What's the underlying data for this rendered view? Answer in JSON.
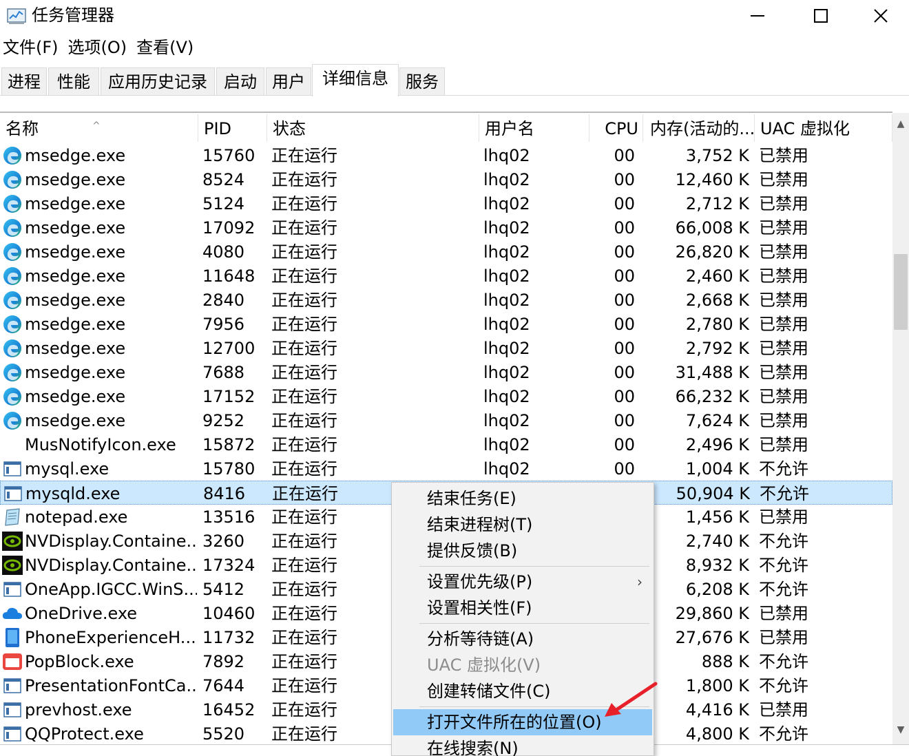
{
  "window": {
    "title": "任务管理器",
    "controls": [
      "minimize",
      "maximize",
      "close"
    ]
  },
  "menu": [
    "文件(F)",
    "选项(O)",
    "查看(V)"
  ],
  "tabs": [
    "进程",
    "性能",
    "应用历史记录",
    "启动",
    "用户",
    "详细信息",
    "服务"
  ],
  "active_tab": "详细信息",
  "columns": {
    "name": "名称",
    "pid": "PID",
    "status": "状态",
    "user": "用户名",
    "cpu": "CPU",
    "memory": "内存(活动的...",
    "uac": "UAC 虚拟化"
  },
  "rows": [
    {
      "icon": "edge-icon",
      "name": "msedge.exe",
      "pid": "15760",
      "status": "正在运行",
      "user": "lhq02",
      "cpu": "00",
      "mem": "3,752 K",
      "uac": "已禁用"
    },
    {
      "icon": "edge-icon",
      "name": "msedge.exe",
      "pid": "8524",
      "status": "正在运行",
      "user": "lhq02",
      "cpu": "00",
      "mem": "12,460 K",
      "uac": "已禁用"
    },
    {
      "icon": "edge-icon",
      "name": "msedge.exe",
      "pid": "5124",
      "status": "正在运行",
      "user": "lhq02",
      "cpu": "00",
      "mem": "2,712 K",
      "uac": "已禁用"
    },
    {
      "icon": "edge-icon",
      "name": "msedge.exe",
      "pid": "17092",
      "status": "正在运行",
      "user": "lhq02",
      "cpu": "00",
      "mem": "66,008 K",
      "uac": "已禁用"
    },
    {
      "icon": "edge-icon",
      "name": "msedge.exe",
      "pid": "4080",
      "status": "正在运行",
      "user": "lhq02",
      "cpu": "00",
      "mem": "26,820 K",
      "uac": "已禁用"
    },
    {
      "icon": "edge-icon",
      "name": "msedge.exe",
      "pid": "11648",
      "status": "正在运行",
      "user": "lhq02",
      "cpu": "00",
      "mem": "2,460 K",
      "uac": "已禁用"
    },
    {
      "icon": "edge-icon",
      "name": "msedge.exe",
      "pid": "2840",
      "status": "正在运行",
      "user": "lhq02",
      "cpu": "00",
      "mem": "2,668 K",
      "uac": "已禁用"
    },
    {
      "icon": "edge-icon",
      "name": "msedge.exe",
      "pid": "7956",
      "status": "正在运行",
      "user": "lhq02",
      "cpu": "00",
      "mem": "2,780 K",
      "uac": "已禁用"
    },
    {
      "icon": "edge-icon",
      "name": "msedge.exe",
      "pid": "12700",
      "status": "正在运行",
      "user": "lhq02",
      "cpu": "00",
      "mem": "2,792 K",
      "uac": "已禁用"
    },
    {
      "icon": "edge-icon",
      "name": "msedge.exe",
      "pid": "7688",
      "status": "正在运行",
      "user": "lhq02",
      "cpu": "00",
      "mem": "31,488 K",
      "uac": "已禁用"
    },
    {
      "icon": "edge-icon",
      "name": "msedge.exe",
      "pid": "17152",
      "status": "正在运行",
      "user": "lhq02",
      "cpu": "00",
      "mem": "66,232 K",
      "uac": "已禁用"
    },
    {
      "icon": "edge-icon",
      "name": "msedge.exe",
      "pid": "9252",
      "status": "正在运行",
      "user": "lhq02",
      "cpu": "00",
      "mem": "7,624 K",
      "uac": "已禁用"
    },
    {
      "icon": "none",
      "name": "MusNotifyIcon.exe",
      "pid": "15872",
      "status": "正在运行",
      "user": "lhq02",
      "cpu": "00",
      "mem": "2,496 K",
      "uac": "已禁用"
    },
    {
      "icon": "window-app-icon",
      "name": "mysql.exe",
      "pid": "15780",
      "status": "正在运行",
      "user": "lhq02",
      "cpu": "00",
      "mem": "1,004 K",
      "uac": "不允许"
    },
    {
      "icon": "window-app-icon",
      "name": "mysqld.exe",
      "pid": "8416",
      "status": "正在运行",
      "user": "",
      "cpu": "",
      "mem": "50,904 K",
      "uac": "不允许",
      "selected": true
    },
    {
      "icon": "notepad-icon",
      "name": "notepad.exe",
      "pid": "13516",
      "status": "正在运行",
      "user": "",
      "cpu": "",
      "mem": "1,456 K",
      "uac": "已禁用"
    },
    {
      "icon": "nvidia-icon",
      "name": "NVDisplay.Containe...",
      "pid": "3260",
      "status": "正在运行",
      "user": "",
      "cpu": "",
      "mem": "2,740 K",
      "uac": "不允许"
    },
    {
      "icon": "nvidia-icon",
      "name": "NVDisplay.Containe...",
      "pid": "17324",
      "status": "正在运行",
      "user": "",
      "cpu": "",
      "mem": "8,932 K",
      "uac": "不允许"
    },
    {
      "icon": "window-app-icon",
      "name": "OneApp.IGCC.WinS...",
      "pid": "5412",
      "status": "正在运行",
      "user": "",
      "cpu": "",
      "mem": "6,208 K",
      "uac": "不允许"
    },
    {
      "icon": "onedrive-icon",
      "name": "OneDrive.exe",
      "pid": "10460",
      "status": "正在运行",
      "user": "",
      "cpu": "",
      "mem": "29,860 K",
      "uac": "已禁用"
    },
    {
      "icon": "phone-icon",
      "name": "PhoneExperienceH...",
      "pid": "11732",
      "status": "正在运行",
      "user": "",
      "cpu": "",
      "mem": "27,676 K",
      "uac": "已禁用"
    },
    {
      "icon": "popblock-icon",
      "name": "PopBlock.exe",
      "pid": "7892",
      "status": "正在运行",
      "user": "",
      "cpu": "",
      "mem": "888 K",
      "uac": "不允许"
    },
    {
      "icon": "window-app-icon",
      "name": "PresentationFontCa...",
      "pid": "7644",
      "status": "正在运行",
      "user": "",
      "cpu": "",
      "mem": "1,800 K",
      "uac": "不允许"
    },
    {
      "icon": "window-app-icon",
      "name": "prevhost.exe",
      "pid": "16452",
      "status": "正在运行",
      "user": "",
      "cpu": "",
      "mem": "4,416 K",
      "uac": "已禁用"
    },
    {
      "icon": "window-app-icon",
      "name": "QQProtect.exe",
      "pid": "5520",
      "status": "正在运行",
      "user": "",
      "cpu": "",
      "mem": "4,800 K",
      "uac": "不允许"
    }
  ],
  "context_menu": {
    "items": [
      {
        "label": "结束任务(E)",
        "state": "enabled"
      },
      {
        "label": "结束进程树(T)",
        "state": "enabled"
      },
      {
        "label": "提供反馈(B)",
        "state": "enabled"
      },
      {
        "label": "设置优先级(P)",
        "state": "enabled",
        "submenu": true
      },
      {
        "label": "设置相关性(F)",
        "state": "enabled"
      },
      {
        "label": "分析等待链(A)",
        "state": "enabled"
      },
      {
        "label": "UAC 虚拟化(V)",
        "state": "disabled"
      },
      {
        "label": "创建转储文件(C)",
        "state": "enabled"
      },
      {
        "label": "打开文件所在的位置(O)",
        "state": "highlighted"
      },
      {
        "label": "在线搜索(N)",
        "state": "enabled"
      }
    ],
    "highlight_color": "#91c9f7"
  },
  "colors": {
    "selection": "#cce8ff",
    "annotation_arrow": "#e8202a"
  }
}
